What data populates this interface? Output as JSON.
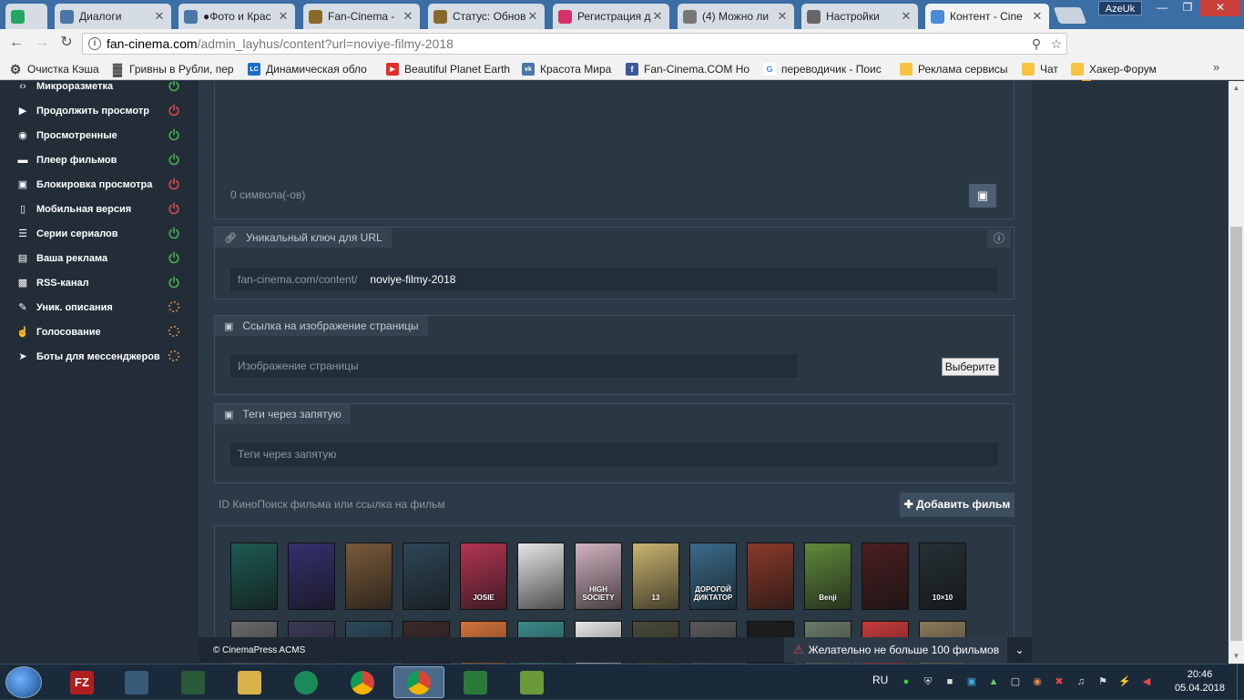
{
  "tabs": [
    {
      "title": "",
      "icon": "sheets-icon",
      "color": "#23a566"
    },
    {
      "title": "Диалоги",
      "icon": "chat-icon",
      "color": "#4a76a8"
    },
    {
      "title": "●Фото и Крас",
      "icon": "vk-icon",
      "color": "#4a76a8"
    },
    {
      "title": "Fan-Cinema -",
      "icon": "film-icon",
      "color": "#8a6a2a"
    },
    {
      "title": "Статус: Обнов",
      "icon": "film-icon",
      "color": "#8a6a2a"
    },
    {
      "title": "Регистрация д",
      "icon": "register-icon",
      "color": "#d5306a"
    },
    {
      "title": "(4) Можно ли",
      "icon": "forum-icon",
      "color": "#777777"
    },
    {
      "title": "Настройки",
      "icon": "gear-icon",
      "color": "#666666"
    },
    {
      "title": "Контент - Cine",
      "icon": "database-icon",
      "color": "#4a8bd6"
    }
  ],
  "user_label": "AzeUk",
  "url": {
    "host": "fan-cinema.com",
    "path": "/admin_layhus/content?url=noviye-filmy-2018"
  },
  "bookmarks": [
    {
      "label": "Очистка Кэша",
      "icon": "gear-icon",
      "color": "#555555"
    },
    {
      "label": "Гривны в Рубли, пер",
      "icon": "calculator-icon",
      "color": "#333333"
    },
    {
      "label": "Динамическая обло",
      "icon": "lc-icon",
      "color": "#1b6fc4"
    },
    {
      "label": "Beautiful Planet Earth",
      "icon": "youtube-icon",
      "color": "#e52d27"
    },
    {
      "label": "Красота Мира",
      "icon": "vk-icon",
      "color": "#4a76a8"
    },
    {
      "label": "Fan-Cinema.COM Но",
      "icon": "facebook-icon",
      "color": "#3b5998"
    },
    {
      "label": "переводичик - Поис",
      "icon": "google-icon",
      "color": "#ffffff"
    },
    {
      "label": "Реклама сервисы",
      "icon": "folder-icon",
      "color": "#f5c542"
    },
    {
      "label": "Чат",
      "icon": "folder-icon",
      "color": "#f5c542"
    },
    {
      "label": "Хакер-Форум",
      "icon": "folder-icon",
      "color": "#f5c542"
    }
  ],
  "sidebar": [
    {
      "label": "Микроразметка",
      "icon": "code-icon",
      "status": "on"
    },
    {
      "label": "Продолжить просмотр",
      "icon": "play-icon",
      "status": "off"
    },
    {
      "label": "Просмотренные",
      "icon": "eye-icon",
      "status": "on"
    },
    {
      "label": "Плеер фильмов",
      "icon": "monitor-icon",
      "status": "on"
    },
    {
      "label": "Блокировка просмотра",
      "icon": "lock-icon",
      "status": "off"
    },
    {
      "label": "Мобильная версия",
      "icon": "mobile-icon",
      "status": "off"
    },
    {
      "label": "Серии сериалов",
      "icon": "list-icon",
      "status": "on"
    },
    {
      "label": "Ваша реклама",
      "icon": "money-icon",
      "status": "on"
    },
    {
      "label": "RSS-канал",
      "icon": "rss-icon",
      "status": "on"
    },
    {
      "label": "Уник. описания",
      "icon": "pencil-icon",
      "status": "pending"
    },
    {
      "label": "Голосование",
      "icon": "thumbs-up-icon",
      "status": "pending"
    },
    {
      "label": "Боты для мессенджеров",
      "icon": "telegram-icon",
      "status": "pending"
    }
  ],
  "status_colors": {
    "on": "#4caf50",
    "off": "#e04848",
    "pending": "#e8913a"
  },
  "editor": {
    "char_count": "0 символа(-ов)"
  },
  "url_key": {
    "label": "Уникальный ключ для URL",
    "prefix": "fan-cinema.com/content/",
    "value": "noviye-filmy-2018"
  },
  "page_image": {
    "label": "Ссылка на изображение страницы",
    "placeholder": "Изображение страницы",
    "button": "Выберите"
  },
  "tags": {
    "label": "Теги через запятую",
    "placeholder": "Теги через запятую"
  },
  "film_add": {
    "placeholder": "ID КиноПоиск фильма или ссылка на фильм",
    "button": "Добавить фильм"
  },
  "posters_row1": [
    {
      "title": "",
      "color": "#1d5a52"
    },
    {
      "title": "",
      "color": "#35306e"
    },
    {
      "title": "",
      "color": "#7a5a3a"
    },
    {
      "title": "",
      "color": "#2f4758"
    },
    {
      "title": "JOSIE",
      "color": "#b43555"
    },
    {
      "title": "",
      "color": "#e6e6e6"
    },
    {
      "title": "HIGH SOCIETY",
      "color": "#d3b3c0"
    },
    {
      "title": "13",
      "color": "#c9b470"
    },
    {
      "title": "ДОРОГОЙ ДИКТАТОР",
      "color": "#3a6b8a"
    },
    {
      "title": "",
      "color": "#8a3a2a"
    },
    {
      "title": "Benji",
      "color": "#5f8a3a"
    },
    {
      "title": "",
      "color": "#4a1e22"
    },
    {
      "title": "10×10",
      "color": "#253035"
    }
  ],
  "posters_row2": [
    {
      "color": "#6a6a6a"
    },
    {
      "color": "#3a3a55"
    },
    {
      "color": "#2c4a5a"
    },
    {
      "color": "#3a2a2a"
    },
    {
      "color": "#d4733a"
    },
    {
      "color": "#3a8a8a"
    },
    {
      "color": "#e6e6e6"
    },
    {
      "color": "#4a4a3a"
    },
    {
      "color": "#5a5a5a"
    },
    {
      "color": "#1e1e1e"
    },
    {
      "color": "#6a7a6a"
    },
    {
      "color": "#c83a3a"
    },
    {
      "color": "#8a7a5a"
    }
  ],
  "footer": {
    "copyright": "© CinemaPress ACMS",
    "warning": "Желательно не больше 100 фильмов"
  },
  "taskbar": {
    "lang": "RU",
    "time": "20:46",
    "date": "05.04.2018",
    "apps": [
      {
        "name": "filezilla",
        "color": "#b01e1e",
        "label": "FZ"
      },
      {
        "name": "network",
        "color": "#3a5a7a",
        "label": ""
      },
      {
        "name": "terminal",
        "color": "#2a5a3a",
        "label": ""
      },
      {
        "name": "explorer",
        "color": "#d8b24a",
        "label": ""
      },
      {
        "name": "opera",
        "color": "#1a8a5a",
        "label": ""
      },
      {
        "name": "chrome",
        "color": "#3a7a3a",
        "label": ""
      },
      {
        "name": "chrome-active",
        "color": "#4a6a8a",
        "label": ""
      },
      {
        "name": "download-manager",
        "color": "#2a7a3a",
        "label": ""
      },
      {
        "name": "notepad",
        "color": "#6a9a3a",
        "label": ""
      }
    ]
  }
}
